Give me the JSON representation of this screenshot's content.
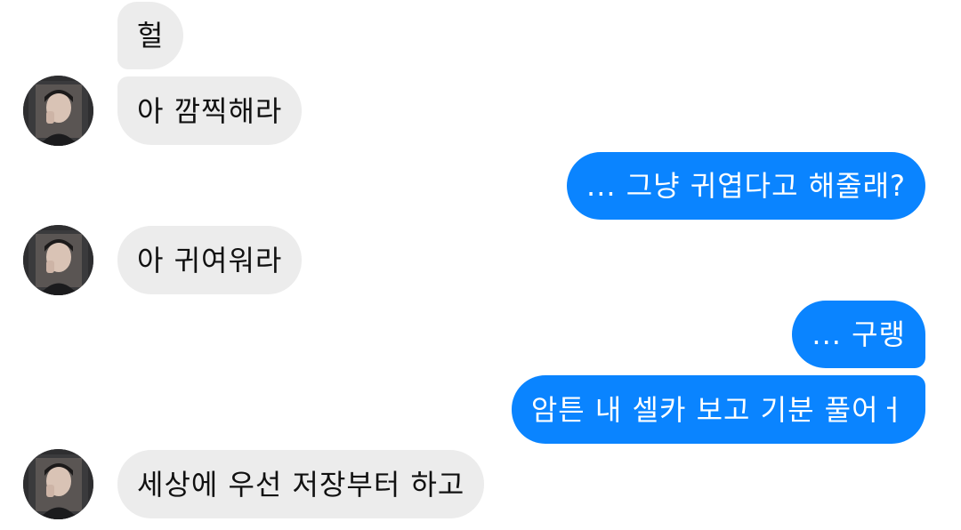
{
  "messages": [
    {
      "id": "m1",
      "side": "received",
      "text": "헐"
    },
    {
      "id": "m2",
      "side": "received",
      "text": "아 깜찍해라"
    },
    {
      "id": "m3",
      "side": "sent",
      "text": "... 그냥 귀엽다고 해줄래?"
    },
    {
      "id": "m4",
      "side": "received",
      "text": "아 귀여워라"
    },
    {
      "id": "m5",
      "side": "sent",
      "text": "... 구랭"
    },
    {
      "id": "m6",
      "side": "sent",
      "text": "암튼 내 셀카 보고 기분 풀어ㅓ"
    },
    {
      "id": "m7",
      "side": "received",
      "text": "세상에 우선 저장부터 하고"
    }
  ],
  "colors": {
    "received_bubble": "#ececec",
    "sent_bubble": "#0a84ff",
    "received_text": "#111111",
    "sent_text": "#ffffff"
  },
  "avatar_icon": "profile-photo"
}
